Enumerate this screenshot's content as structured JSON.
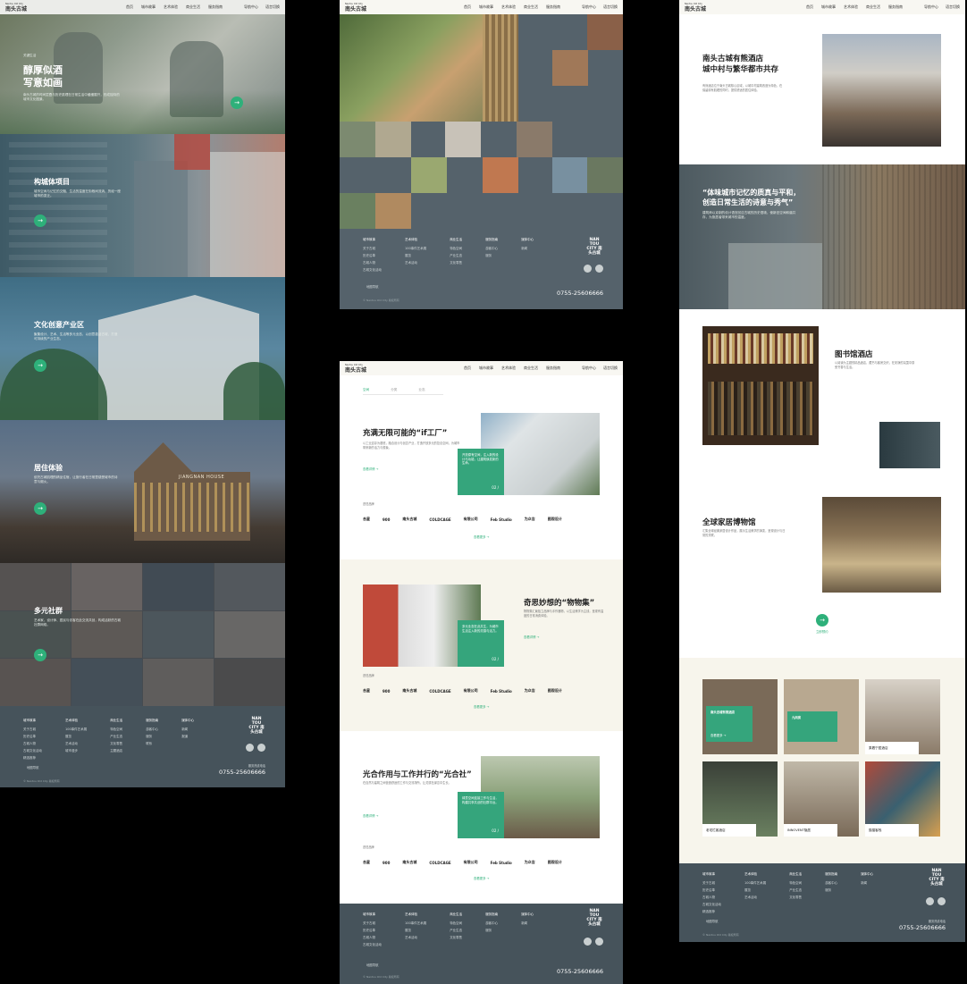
{
  "nav": {
    "logo": "南头古城",
    "logo_sub": "Nantou Old City",
    "links": [
      "首页",
      "城市故事",
      "艺术体验",
      "商业生活",
      "服务指南"
    ],
    "tools": [
      "导航中心",
      "语言切换"
    ]
  },
  "panel1": {
    "hero_title_1": "醇厚似酒",
    "hero_title_2": "写意如画",
    "hero_tag": "关键生活",
    "hero_desc": "南头古城的时间层叠与历史肌理在日常生活中缓缓展开，形成独特的城市文化图景。",
    "s1_title": "构城体项目",
    "s1_desc": "城市空间与记忆的交融，生活的温度在街巷间流淌，历经一座城市的变迁。",
    "s2_title": "文化创意产业区",
    "s2_desc": "聚集设计、艺术、生活等多元业态，以创意激活古城，打造可持续的产业生态。",
    "s3_title": "居住体验",
    "s3_desc": "依托古城肌理的精品住宿，让旅行者在日常里感受城市的诗意与烟火。",
    "s4_title": "多元社群",
    "s4_desc": "艺术家、设计师、居民与访客在此交流共创，构成活跃的古城社群网络。",
    "building_sign": "JIANGNAN HOUSE",
    "arrow": "→"
  },
  "footer": {
    "columns": [
      {
        "head": "城市故事",
        "items": [
          "关于古城",
          "历史沿革",
          "古城人物",
          "古城文化活动",
          "精选推荐"
        ]
      },
      {
        "head": "艺术体验",
        "items": [
          "100事件艺术展",
          "展览",
          "艺术活动",
          "城市漫步"
        ]
      },
      {
        "head": "商业生活",
        "items": [
          "特色空间",
          "产业生态",
          "文化零售",
          "主题酒店"
        ]
      },
      {
        "head": "服务指南",
        "items": [
          "游客中心",
          "服务",
          "联系"
        ]
      },
      {
        "head": "媒体中心",
        "items": [
          "新闻",
          "报道"
        ]
      }
    ],
    "brand": "NAN TOU CITY 南头古城",
    "phone_label": "服务热线电话",
    "phone": "0755-25606666",
    "address": "地图导航",
    "copyright": "© Nantou Old City 版权所有"
  },
  "panel2": {
    "nav_item": "首页"
  },
  "panel3": {
    "tabs": [
      "空间",
      "分类",
      "业态"
    ],
    "a_title": "充满无限可能的“if工厂”",
    "a_desc": "以工业遗存为基底，融合设计与创意产业，打造开放多元的复合空间，为城市带来新的活力与想象。",
    "a_more": "查看详情 →",
    "a_card": "开放原有空间，注入新的设计与功能，让建筑焕发新的生命。",
    "a_page": "02 /",
    "b_title": "奇思妙想的“物物集”",
    "b_desc": "物物集汇聚独立品牌与手作器物，以生活美学为主线，呈现有温度的日常消费体验。",
    "b_more": "查看详情 →",
    "b_card": "多元业态在此共生，为城市生活注入新的灵感与活力。",
    "b_page": "02 /",
    "c_title": "光合作用与工作并行的“光合社”",
    "c_desc": "在自然与建筑之间营造舒适的工作与交流场所，让灵感在绿意中生长。",
    "c_more": "查看详情 →",
    "c_card": "绿意空间连接工作与生活，构建共享共创的社群平台。",
    "c_page": "02 /",
    "logos_label": "进驻品牌",
    "logos": [
      "合星",
      "900",
      "南头古城",
      "COLDCAGE",
      "有限公司",
      "Feb Studio",
      "为众吉",
      "图观设计"
    ],
    "view_more": "查看更多 →"
  },
  "panel4": {
    "hotel_title": "南头古城有熊酒店\n城中村与繁华都市共存",
    "hotel_desc": "有熊酒店位于南头古城核心区域，以城中村建筑改造为特色，在保留原有肌理的同时，提供舒适的居住体验。",
    "quote": "“体味城市记忆的质真与平和，\n创造日常生活的诗意与秀气”",
    "quote_desc": "建筑师以克制的设计语言回应古城的历史语境，使新旧空间和谐共存，为旅居者带来城市的温度。",
    "library_title": "图书馆酒店",
    "library_desc": "以阅读为主题的精品酒店，藏书与客房交织，在安静的氛围中感受书香与生活。",
    "museum_title": "全球家居博物馆",
    "museum_desc": "汇集全球经典家居设计作品，展示生活美学的演变，呈现设计与日常的关联。",
    "museum_more": "立即预约",
    "cards": [
      {
        "label": "南头古城有熊酒店",
        "green": true
      },
      {
        "label": "九间房",
        "green": true
      },
      {
        "label": "乘着宁居酒店",
        "green": false
      },
      {
        "label": "老宅栏客酒店",
        "green": false
      },
      {
        "label": "INNOVENT隐居",
        "green": false
      },
      {
        "label": "猫猫客栈",
        "green": false
      }
    ],
    "card_more": "查看更多 →"
  },
  "colors": {
    "accent": "#2eb07a",
    "card_green": "#35a57c",
    "footer_bg": "#46535b",
    "slate": "#55626b",
    "cream": "#f7f5ec"
  }
}
